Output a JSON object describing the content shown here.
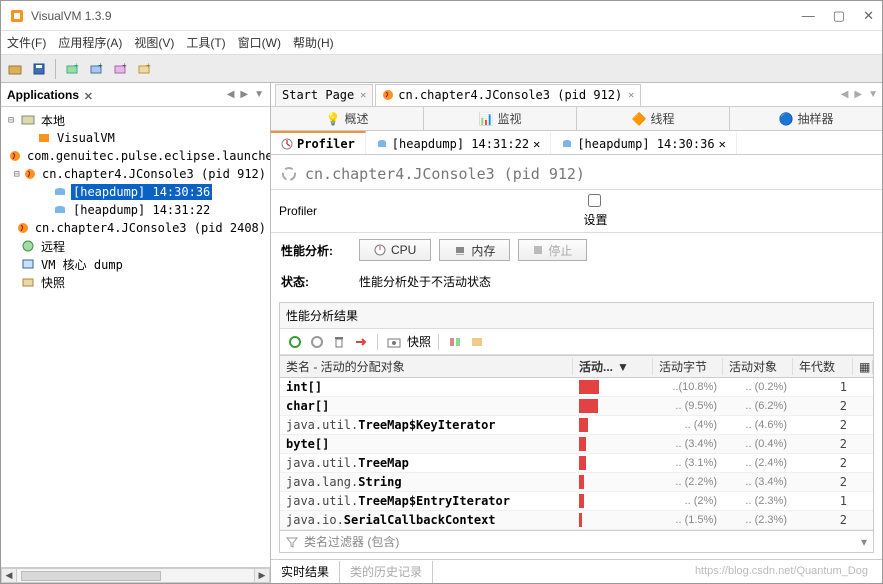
{
  "window": {
    "title": "VisualVM 1.3.9"
  },
  "menu": [
    "文件(F)",
    "应用程序(A)",
    "视图(V)",
    "工具(T)",
    "窗口(W)",
    "帮助(H)"
  ],
  "left_panel": {
    "title": "Applications",
    "tree": [
      {
        "depth": 0,
        "exp": "-",
        "icon": "host",
        "label": "本地"
      },
      {
        "depth": 1,
        "exp": "",
        "icon": "vvm",
        "label": "VisualVM"
      },
      {
        "depth": 1,
        "exp": "",
        "icon": "java",
        "label": "com.genuitec.pulse.eclipse.launche"
      },
      {
        "depth": 1,
        "exp": "-",
        "icon": "java",
        "label": "cn.chapter4.JConsole3 (pid 912)"
      },
      {
        "depth": 2,
        "exp": "",
        "icon": "heap",
        "label": "[heapdump] 14:30:36",
        "selected": true
      },
      {
        "depth": 2,
        "exp": "",
        "icon": "heap",
        "label": "[heapdump] 14:31:22"
      },
      {
        "depth": 1,
        "exp": "",
        "icon": "java",
        "label": "cn.chapter4.JConsole3 (pid 2408)"
      },
      {
        "depth": 0,
        "exp": "",
        "icon": "remote",
        "label": "远程"
      },
      {
        "depth": 0,
        "exp": "",
        "icon": "dump",
        "label": "VM 核心 dump"
      },
      {
        "depth": 0,
        "exp": "",
        "icon": "snap",
        "label": "快照"
      }
    ]
  },
  "editor_tabs": [
    {
      "icon": "",
      "label": "Start Page",
      "active": false
    },
    {
      "icon": "java",
      "label": "cn.chapter4.JConsole3 (pid 912)",
      "active": true
    }
  ],
  "subtabs": [
    {
      "icon": "overview",
      "label": "概述",
      "active": false
    },
    {
      "icon": "monitor",
      "label": "监视",
      "active": false
    },
    {
      "icon": "threads",
      "label": "线程",
      "active": false
    },
    {
      "icon": "sampler",
      "label": "抽样器",
      "active": false
    }
  ],
  "subtabs2": [
    {
      "icon": "profiler",
      "label": "Profiler",
      "active": true
    },
    {
      "icon": "heap",
      "label": "[heapdump] 14:31:22",
      "active": false
    },
    {
      "icon": "heap",
      "label": "[heapdump] 14:30:36",
      "active": false
    }
  ],
  "heading": "cn.chapter4.JConsole3 (pid 912)",
  "panel_label": "Profiler",
  "settings_label": "设置",
  "ctrl": {
    "perf_label": "性能分析:",
    "cpu": "CPU",
    "mem": "内存",
    "stop": "停止",
    "status_label": "状态:",
    "status_value": "性能分析处于不活动状态"
  },
  "results": {
    "title": "性能分析结果",
    "snapshot": "快照",
    "columns": [
      "类名 - 活动的分配对象",
      "活动...",
      "活动字节",
      "活动对象",
      "年代数",
      ""
    ],
    "rows": [
      {
        "name_pre": "",
        "name_bold": "int[]",
        "bar": 30,
        "bytes": "..(10.8%)",
        "objs": ".. (0.2%)",
        "gen": "1"
      },
      {
        "name_pre": "",
        "name_bold": "char[]",
        "bar": 28,
        "bytes": ".. (9.5%)",
        "objs": ".. (6.2%)",
        "gen": "2"
      },
      {
        "name_pre": "java.util.",
        "name_bold": "TreeMap$KeyIterator",
        "bar": 13,
        "bytes": ".. (4%)",
        "objs": ".. (4.6%)",
        "gen": "2"
      },
      {
        "name_pre": "",
        "name_bold": "byte[]",
        "bar": 11,
        "bytes": ".. (3.4%)",
        "objs": ".. (0.4%)",
        "gen": "2"
      },
      {
        "name_pre": "java.util.",
        "name_bold": "TreeMap",
        "bar": 10,
        "bytes": ".. (3.1%)",
        "objs": ".. (2.4%)",
        "gen": "2"
      },
      {
        "name_pre": "java.lang.",
        "name_bold": "String",
        "bar": 8,
        "bytes": ".. (2.2%)",
        "objs": ".. (3.4%)",
        "gen": "2"
      },
      {
        "name_pre": "java.util.",
        "name_bold": "TreeMap$EntryIterator",
        "bar": 7,
        "bytes": ".. (2%)",
        "objs": ".. (2.3%)",
        "gen": "1"
      },
      {
        "name_pre": "java.io.",
        "name_bold": "SerialCallbackContext",
        "bar": 5,
        "bytes": ".. (1.5%)",
        "objs": ".. (2.3%)",
        "gen": "2"
      }
    ],
    "filter": "类名过滤器 (包含)"
  },
  "bottom_tabs": [
    "实时结果",
    "类的历史记录"
  ],
  "watermark": "https://blog.csdn.net/Quantum_Dog"
}
